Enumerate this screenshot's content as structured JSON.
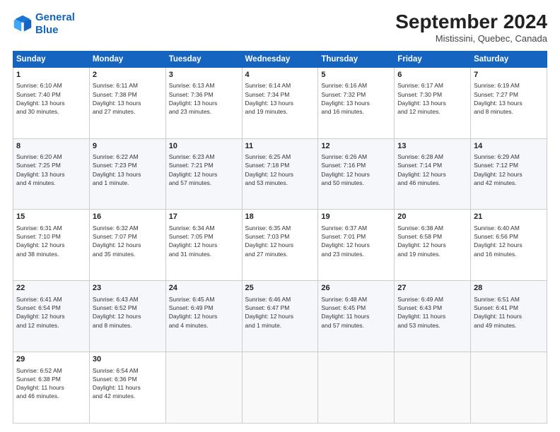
{
  "logo": {
    "line1": "General",
    "line2": "Blue"
  },
  "title": "September 2024",
  "subtitle": "Mistissini, Quebec, Canada",
  "days_header": [
    "Sunday",
    "Monday",
    "Tuesday",
    "Wednesday",
    "Thursday",
    "Friday",
    "Saturday"
  ],
  "weeks": [
    [
      {
        "day": "1",
        "info": "Sunrise: 6:10 AM\nSunset: 7:40 PM\nDaylight: 13 hours\nand 30 minutes."
      },
      {
        "day": "2",
        "info": "Sunrise: 6:11 AM\nSunset: 7:38 PM\nDaylight: 13 hours\nand 27 minutes."
      },
      {
        "day": "3",
        "info": "Sunrise: 6:13 AM\nSunset: 7:36 PM\nDaylight: 13 hours\nand 23 minutes."
      },
      {
        "day": "4",
        "info": "Sunrise: 6:14 AM\nSunset: 7:34 PM\nDaylight: 13 hours\nand 19 minutes."
      },
      {
        "day": "5",
        "info": "Sunrise: 6:16 AM\nSunset: 7:32 PM\nDaylight: 13 hours\nand 16 minutes."
      },
      {
        "day": "6",
        "info": "Sunrise: 6:17 AM\nSunset: 7:30 PM\nDaylight: 13 hours\nand 12 minutes."
      },
      {
        "day": "7",
        "info": "Sunrise: 6:19 AM\nSunset: 7:27 PM\nDaylight: 13 hours\nand 8 minutes."
      }
    ],
    [
      {
        "day": "8",
        "info": "Sunrise: 6:20 AM\nSunset: 7:25 PM\nDaylight: 13 hours\nand 4 minutes."
      },
      {
        "day": "9",
        "info": "Sunrise: 6:22 AM\nSunset: 7:23 PM\nDaylight: 13 hours\nand 1 minute."
      },
      {
        "day": "10",
        "info": "Sunrise: 6:23 AM\nSunset: 7:21 PM\nDaylight: 12 hours\nand 57 minutes."
      },
      {
        "day": "11",
        "info": "Sunrise: 6:25 AM\nSunset: 7:18 PM\nDaylight: 12 hours\nand 53 minutes."
      },
      {
        "day": "12",
        "info": "Sunrise: 6:26 AM\nSunset: 7:16 PM\nDaylight: 12 hours\nand 50 minutes."
      },
      {
        "day": "13",
        "info": "Sunrise: 6:28 AM\nSunset: 7:14 PM\nDaylight: 12 hours\nand 46 minutes."
      },
      {
        "day": "14",
        "info": "Sunrise: 6:29 AM\nSunset: 7:12 PM\nDaylight: 12 hours\nand 42 minutes."
      }
    ],
    [
      {
        "day": "15",
        "info": "Sunrise: 6:31 AM\nSunset: 7:10 PM\nDaylight: 12 hours\nand 38 minutes."
      },
      {
        "day": "16",
        "info": "Sunrise: 6:32 AM\nSunset: 7:07 PM\nDaylight: 12 hours\nand 35 minutes."
      },
      {
        "day": "17",
        "info": "Sunrise: 6:34 AM\nSunset: 7:05 PM\nDaylight: 12 hours\nand 31 minutes."
      },
      {
        "day": "18",
        "info": "Sunrise: 6:35 AM\nSunset: 7:03 PM\nDaylight: 12 hours\nand 27 minutes."
      },
      {
        "day": "19",
        "info": "Sunrise: 6:37 AM\nSunset: 7:01 PM\nDaylight: 12 hours\nand 23 minutes."
      },
      {
        "day": "20",
        "info": "Sunrise: 6:38 AM\nSunset: 6:58 PM\nDaylight: 12 hours\nand 19 minutes."
      },
      {
        "day": "21",
        "info": "Sunrise: 6:40 AM\nSunset: 6:56 PM\nDaylight: 12 hours\nand 16 minutes."
      }
    ],
    [
      {
        "day": "22",
        "info": "Sunrise: 6:41 AM\nSunset: 6:54 PM\nDaylight: 12 hours\nand 12 minutes."
      },
      {
        "day": "23",
        "info": "Sunrise: 6:43 AM\nSunset: 6:52 PM\nDaylight: 12 hours\nand 8 minutes."
      },
      {
        "day": "24",
        "info": "Sunrise: 6:45 AM\nSunset: 6:49 PM\nDaylight: 12 hours\nand 4 minutes."
      },
      {
        "day": "25",
        "info": "Sunrise: 6:46 AM\nSunset: 6:47 PM\nDaylight: 12 hours\nand 1 minute."
      },
      {
        "day": "26",
        "info": "Sunrise: 6:48 AM\nSunset: 6:45 PM\nDaylight: 11 hours\nand 57 minutes."
      },
      {
        "day": "27",
        "info": "Sunrise: 6:49 AM\nSunset: 6:43 PM\nDaylight: 11 hours\nand 53 minutes."
      },
      {
        "day": "28",
        "info": "Sunrise: 6:51 AM\nSunset: 6:41 PM\nDaylight: 11 hours\nand 49 minutes."
      }
    ],
    [
      {
        "day": "29",
        "info": "Sunrise: 6:52 AM\nSunset: 6:38 PM\nDaylight: 11 hours\nand 46 minutes."
      },
      {
        "day": "30",
        "info": "Sunrise: 6:54 AM\nSunset: 6:36 PM\nDaylight: 11 hours\nand 42 minutes."
      },
      {
        "day": "",
        "info": ""
      },
      {
        "day": "",
        "info": ""
      },
      {
        "day": "",
        "info": ""
      },
      {
        "day": "",
        "info": ""
      },
      {
        "day": "",
        "info": ""
      }
    ]
  ]
}
